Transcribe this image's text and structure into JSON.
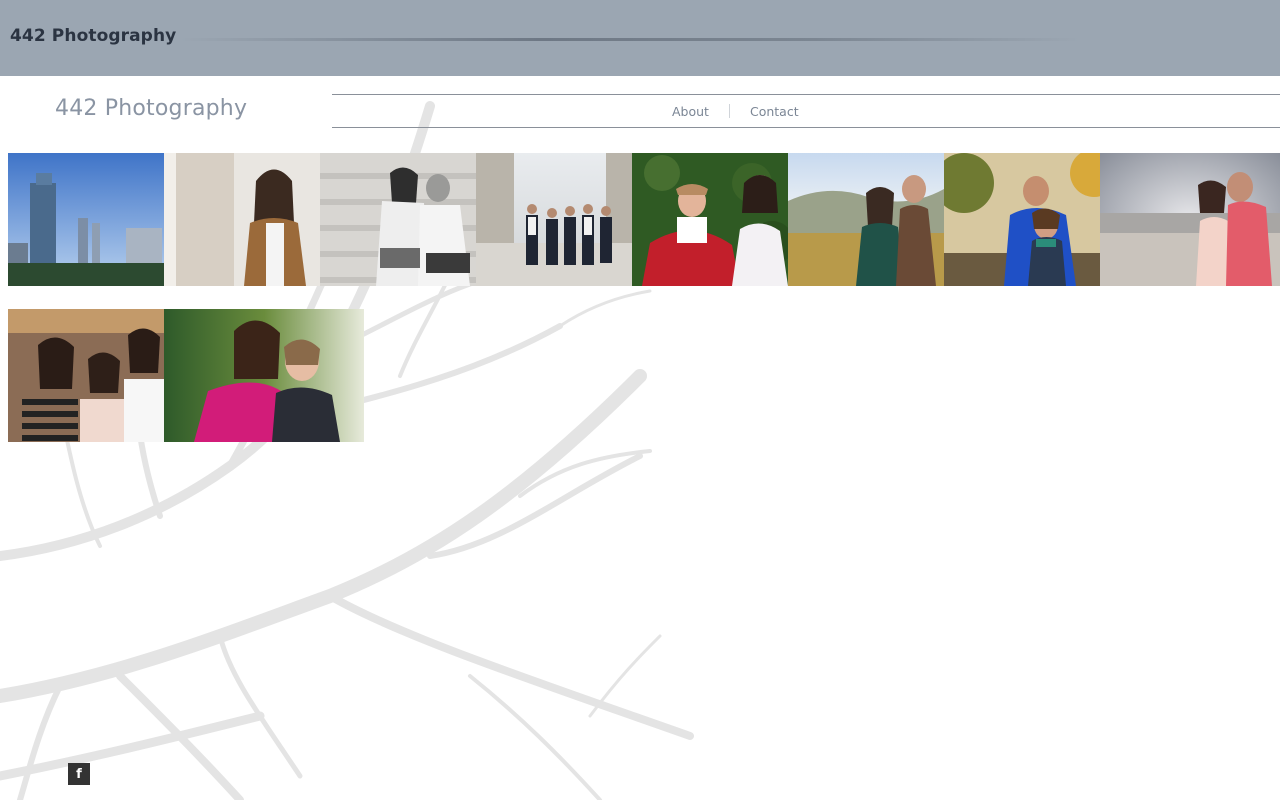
{
  "header": {
    "title": "442 Photography"
  },
  "site": {
    "logo": "442 Photography"
  },
  "nav": {
    "items": [
      {
        "label": "About"
      },
      {
        "label": "Contact"
      }
    ]
  },
  "gallery": {
    "photos": [
      {
        "subject": "city skyline"
      },
      {
        "subject": "woman in leopard coat"
      },
      {
        "subject": "couple on steps black and white"
      },
      {
        "subject": "family group on plaza"
      },
      {
        "subject": "baby and girl on grass"
      },
      {
        "subject": "couple in vineyard"
      },
      {
        "subject": "couple hugging outdoors"
      },
      {
        "subject": "couple at beach"
      },
      {
        "subject": "three sisters"
      },
      {
        "subject": "two kids hugging"
      }
    ]
  },
  "social": {
    "facebook_icon": "facebook-icon",
    "facebook_glyph": "f"
  }
}
